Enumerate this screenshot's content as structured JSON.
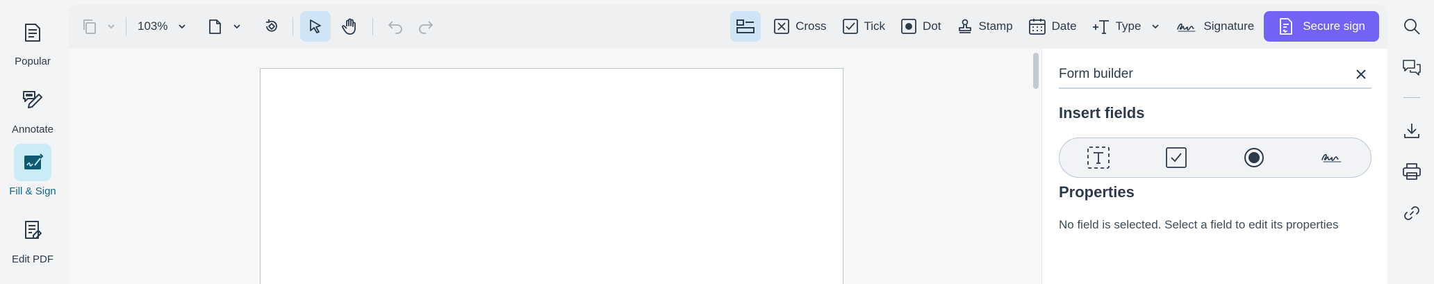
{
  "left_rail": {
    "items": [
      {
        "label": "Popular",
        "icon": "popular-icon",
        "active": false
      },
      {
        "label": "Annotate",
        "icon": "annotate-icon",
        "active": false
      },
      {
        "label": "Fill & Sign",
        "icon": "fill-sign-icon",
        "active": true
      },
      {
        "label": "Edit PDF",
        "icon": "edit-pdf-icon",
        "active": false
      }
    ]
  },
  "toolbar": {
    "zoom": "103%",
    "tools": {
      "cross": "Cross",
      "tick": "Tick",
      "dot": "Dot",
      "stamp": "Stamp",
      "date": "Date",
      "type": "Type",
      "signature": "Signature"
    },
    "secure_sign": "Secure sign"
  },
  "panel": {
    "title": "Form builder",
    "insert_title": "Insert fields",
    "properties_title": "Properties",
    "properties_empty": "No field is selected. Select a field to edit its properties"
  },
  "colors": {
    "accent": "#7163f5",
    "active_tool": "#cfe4f5",
    "active_rail": "#c9ecf5",
    "icon": "#2b3a4d"
  }
}
